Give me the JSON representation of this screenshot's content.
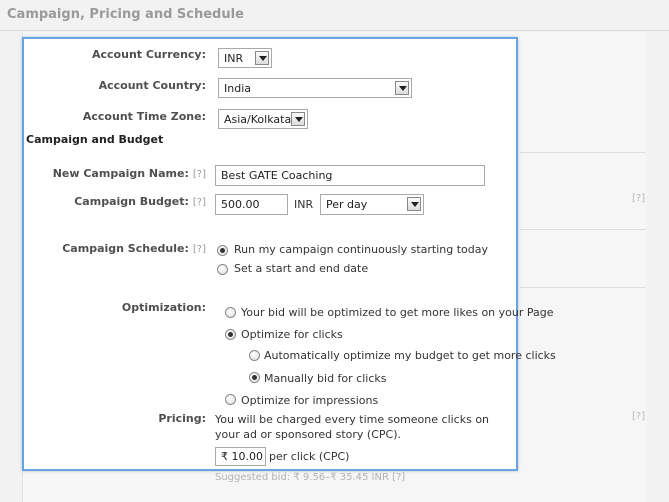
{
  "page": {
    "title": "Campaign, Pricing and Schedule"
  },
  "background": {
    "help_marker": "[?]",
    "suggested_bid": "Suggested bid: ₹ 9.56–₹ 35.45 INR   [?]"
  },
  "account": {
    "currency_label": "Account Currency:",
    "currency_value": "INR",
    "country_label": "Account Country:",
    "country_value": "India",
    "timezone_label": "Account Time Zone:",
    "timezone_value": "Asia/Kolkata"
  },
  "campaign": {
    "section_title": "Campaign and Budget",
    "name_label": "New Campaign Name:",
    "help_marker": "[?]",
    "name_value": "Best GATE Coaching",
    "budget_label": "Campaign Budget:",
    "budget_value": "500.00",
    "budget_currency": "INR",
    "budget_period": "Per day"
  },
  "schedule": {
    "label": "Campaign Schedule:",
    "option_continuous": "Run my campaign continuously starting today",
    "option_dates": "Set a start and end date",
    "selected": "continuous"
  },
  "optimization": {
    "label": "Optimization:",
    "option_likes": "Your bid will be optimized to get more likes on your Page",
    "option_clicks": "Optimize for clicks",
    "sub_auto": "Automatically optimize my budget to get more clicks",
    "sub_manual": "Manually bid for clicks",
    "option_impressions": "Optimize for impressions"
  },
  "pricing": {
    "label": "Pricing:",
    "description": "You will be charged every time someone clicks on your ad or sponsored story (CPC).",
    "bid_value": "₹ 10.00",
    "bid_unit": "per click (CPC)"
  }
}
